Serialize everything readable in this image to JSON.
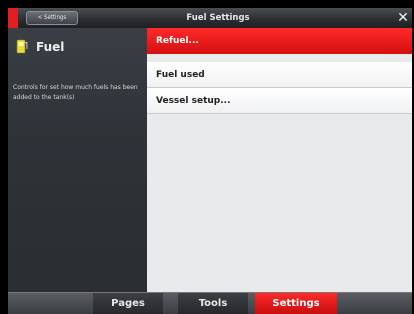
{
  "header": {
    "back_label": "< Settings",
    "title": "Fuel Settings",
    "close_icon": "close-icon"
  },
  "info_panel": {
    "icon": "fuel-icon",
    "title": "Fuel",
    "description": "Controls for set how much fuels has been added to the tank(s)"
  },
  "menu": {
    "items": [
      {
        "label": "Refuel...",
        "selected": true
      },
      {
        "label": "Fuel used",
        "selected": false
      },
      {
        "label": "Vessel setup...",
        "selected": false
      }
    ]
  },
  "tabs": [
    {
      "label": "Pages",
      "active": false
    },
    {
      "label": "Tools",
      "active": false
    },
    {
      "label": "Settings",
      "active": true
    }
  ],
  "colors": {
    "accent": "#e02020",
    "menu_background": "#e9eaec",
    "panel_background": "#2f3338"
  }
}
